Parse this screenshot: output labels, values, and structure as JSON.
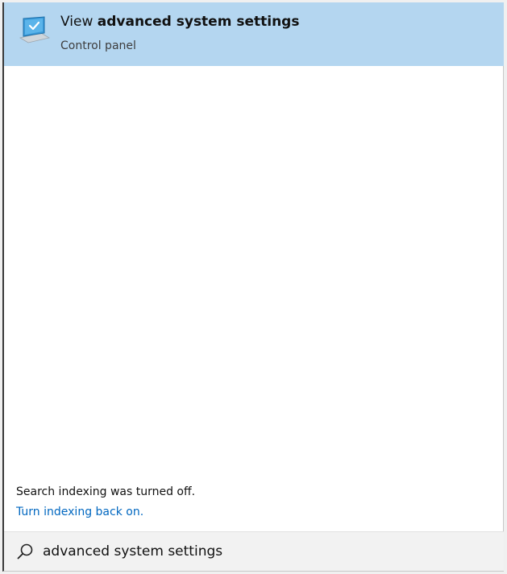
{
  "result": {
    "title_prefix": "View ",
    "title_bold": "advanced system settings",
    "subtitle": "Control panel",
    "icon": "computer-settings-icon"
  },
  "notice": {
    "text": "Search indexing was turned off.",
    "link": "Turn indexing back on."
  },
  "search": {
    "value": "advanced system settings",
    "icon": "search-icon"
  },
  "colors": {
    "selected_bg": "#b4d6f0",
    "link": "#0067c0",
    "searchbar_bg": "#f2f2f2"
  }
}
